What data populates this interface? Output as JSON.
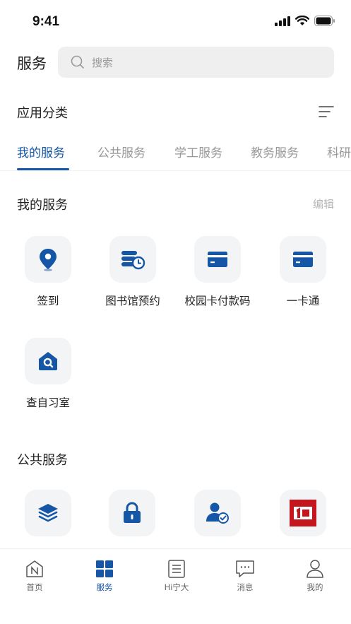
{
  "status_bar": {
    "time": "9:41"
  },
  "header": {
    "title": "服务",
    "search_placeholder": "搜索"
  },
  "categories": {
    "title": "应用分类",
    "tabs": [
      {
        "label": "我的服务",
        "active": true
      },
      {
        "label": "公共服务",
        "active": false
      },
      {
        "label": "学工服务",
        "active": false
      },
      {
        "label": "教务服务",
        "active": false
      },
      {
        "label": "科研",
        "active": false
      }
    ]
  },
  "my_services": {
    "title": "我的服务",
    "edit_label": "编辑",
    "items": [
      {
        "label": "签到",
        "icon": "location-pin-icon"
      },
      {
        "label": "图书馆预约",
        "icon": "library-clock-icon"
      },
      {
        "label": "校园卡付款码",
        "icon": "card-icon"
      },
      {
        "label": "一卡通",
        "icon": "card-icon"
      },
      {
        "label": "查自习室",
        "icon": "study-room-search-icon"
      }
    ]
  },
  "public_services": {
    "title": "公共服务",
    "items": [
      {
        "label": "",
        "icon": "layers-icon"
      },
      {
        "label": "",
        "icon": "lock-icon"
      },
      {
        "label": "",
        "icon": "user-verified-icon"
      },
      {
        "label": "",
        "icon": "red-logo-icon"
      }
    ]
  },
  "tab_bar": {
    "items": [
      {
        "label": "首页",
        "icon": "home-n-icon",
        "active": false
      },
      {
        "label": "服务",
        "icon": "grid-icon",
        "active": true
      },
      {
        "label": "Hi宁大",
        "icon": "document-icon",
        "active": false
      },
      {
        "label": "消息",
        "icon": "message-icon",
        "active": false
      },
      {
        "label": "我的",
        "icon": "person-icon",
        "active": false
      }
    ]
  },
  "colors": {
    "accent": "#1556a6",
    "icon_bg": "#f3f4f6",
    "red_logo": "#c4161c"
  }
}
